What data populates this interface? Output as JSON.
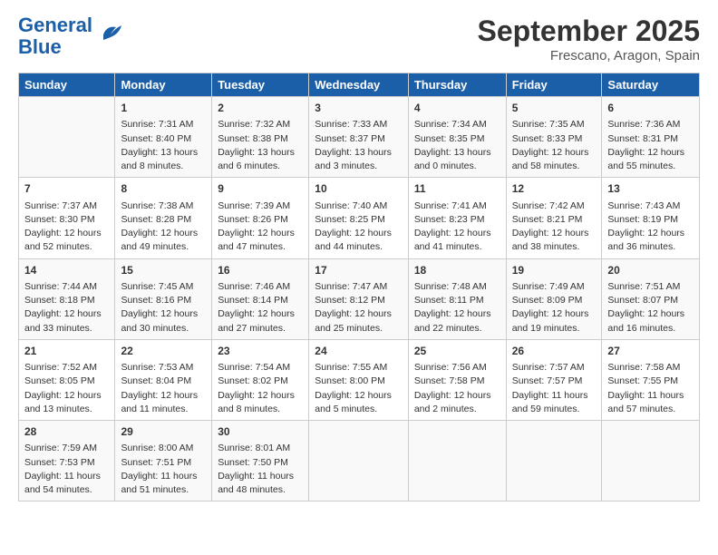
{
  "header": {
    "logo_line1": "General",
    "logo_line2": "Blue",
    "month": "September 2025",
    "location": "Frescano, Aragon, Spain"
  },
  "weekdays": [
    "Sunday",
    "Monday",
    "Tuesday",
    "Wednesday",
    "Thursday",
    "Friday",
    "Saturday"
  ],
  "weeks": [
    [
      {
        "day": "",
        "sunrise": "",
        "sunset": "",
        "daylight": ""
      },
      {
        "day": "1",
        "sunrise": "Sunrise: 7:31 AM",
        "sunset": "Sunset: 8:40 PM",
        "daylight": "Daylight: 13 hours and 8 minutes."
      },
      {
        "day": "2",
        "sunrise": "Sunrise: 7:32 AM",
        "sunset": "Sunset: 8:38 PM",
        "daylight": "Daylight: 13 hours and 6 minutes."
      },
      {
        "day": "3",
        "sunrise": "Sunrise: 7:33 AM",
        "sunset": "Sunset: 8:37 PM",
        "daylight": "Daylight: 13 hours and 3 minutes."
      },
      {
        "day": "4",
        "sunrise": "Sunrise: 7:34 AM",
        "sunset": "Sunset: 8:35 PM",
        "daylight": "Daylight: 13 hours and 0 minutes."
      },
      {
        "day": "5",
        "sunrise": "Sunrise: 7:35 AM",
        "sunset": "Sunset: 8:33 PM",
        "daylight": "Daylight: 12 hours and 58 minutes."
      },
      {
        "day": "6",
        "sunrise": "Sunrise: 7:36 AM",
        "sunset": "Sunset: 8:31 PM",
        "daylight": "Daylight: 12 hours and 55 minutes."
      }
    ],
    [
      {
        "day": "7",
        "sunrise": "Sunrise: 7:37 AM",
        "sunset": "Sunset: 8:30 PM",
        "daylight": "Daylight: 12 hours and 52 minutes."
      },
      {
        "day": "8",
        "sunrise": "Sunrise: 7:38 AM",
        "sunset": "Sunset: 8:28 PM",
        "daylight": "Daylight: 12 hours and 49 minutes."
      },
      {
        "day": "9",
        "sunrise": "Sunrise: 7:39 AM",
        "sunset": "Sunset: 8:26 PM",
        "daylight": "Daylight: 12 hours and 47 minutes."
      },
      {
        "day": "10",
        "sunrise": "Sunrise: 7:40 AM",
        "sunset": "Sunset: 8:25 PM",
        "daylight": "Daylight: 12 hours and 44 minutes."
      },
      {
        "day": "11",
        "sunrise": "Sunrise: 7:41 AM",
        "sunset": "Sunset: 8:23 PM",
        "daylight": "Daylight: 12 hours and 41 minutes."
      },
      {
        "day": "12",
        "sunrise": "Sunrise: 7:42 AM",
        "sunset": "Sunset: 8:21 PM",
        "daylight": "Daylight: 12 hours and 38 minutes."
      },
      {
        "day": "13",
        "sunrise": "Sunrise: 7:43 AM",
        "sunset": "Sunset: 8:19 PM",
        "daylight": "Daylight: 12 hours and 36 minutes."
      }
    ],
    [
      {
        "day": "14",
        "sunrise": "Sunrise: 7:44 AM",
        "sunset": "Sunset: 8:18 PM",
        "daylight": "Daylight: 12 hours and 33 minutes."
      },
      {
        "day": "15",
        "sunrise": "Sunrise: 7:45 AM",
        "sunset": "Sunset: 8:16 PM",
        "daylight": "Daylight: 12 hours and 30 minutes."
      },
      {
        "day": "16",
        "sunrise": "Sunrise: 7:46 AM",
        "sunset": "Sunset: 8:14 PM",
        "daylight": "Daylight: 12 hours and 27 minutes."
      },
      {
        "day": "17",
        "sunrise": "Sunrise: 7:47 AM",
        "sunset": "Sunset: 8:12 PM",
        "daylight": "Daylight: 12 hours and 25 minutes."
      },
      {
        "day": "18",
        "sunrise": "Sunrise: 7:48 AM",
        "sunset": "Sunset: 8:11 PM",
        "daylight": "Daylight: 12 hours and 22 minutes."
      },
      {
        "day": "19",
        "sunrise": "Sunrise: 7:49 AM",
        "sunset": "Sunset: 8:09 PM",
        "daylight": "Daylight: 12 hours and 19 minutes."
      },
      {
        "day": "20",
        "sunrise": "Sunrise: 7:51 AM",
        "sunset": "Sunset: 8:07 PM",
        "daylight": "Daylight: 12 hours and 16 minutes."
      }
    ],
    [
      {
        "day": "21",
        "sunrise": "Sunrise: 7:52 AM",
        "sunset": "Sunset: 8:05 PM",
        "daylight": "Daylight: 12 hours and 13 minutes."
      },
      {
        "day": "22",
        "sunrise": "Sunrise: 7:53 AM",
        "sunset": "Sunset: 8:04 PM",
        "daylight": "Daylight: 12 hours and 11 minutes."
      },
      {
        "day": "23",
        "sunrise": "Sunrise: 7:54 AM",
        "sunset": "Sunset: 8:02 PM",
        "daylight": "Daylight: 12 hours and 8 minutes."
      },
      {
        "day": "24",
        "sunrise": "Sunrise: 7:55 AM",
        "sunset": "Sunset: 8:00 PM",
        "daylight": "Daylight: 12 hours and 5 minutes."
      },
      {
        "day": "25",
        "sunrise": "Sunrise: 7:56 AM",
        "sunset": "Sunset: 7:58 PM",
        "daylight": "Daylight: 12 hours and 2 minutes."
      },
      {
        "day": "26",
        "sunrise": "Sunrise: 7:57 AM",
        "sunset": "Sunset: 7:57 PM",
        "daylight": "Daylight: 11 hours and 59 minutes."
      },
      {
        "day": "27",
        "sunrise": "Sunrise: 7:58 AM",
        "sunset": "Sunset: 7:55 PM",
        "daylight": "Daylight: 11 hours and 57 minutes."
      }
    ],
    [
      {
        "day": "28",
        "sunrise": "Sunrise: 7:59 AM",
        "sunset": "Sunset: 7:53 PM",
        "daylight": "Daylight: 11 hours and 54 minutes."
      },
      {
        "day": "29",
        "sunrise": "Sunrise: 8:00 AM",
        "sunset": "Sunset: 7:51 PM",
        "daylight": "Daylight: 11 hours and 51 minutes."
      },
      {
        "day": "30",
        "sunrise": "Sunrise: 8:01 AM",
        "sunset": "Sunset: 7:50 PM",
        "daylight": "Daylight: 11 hours and 48 minutes."
      },
      {
        "day": "",
        "sunrise": "",
        "sunset": "",
        "daylight": ""
      },
      {
        "day": "",
        "sunrise": "",
        "sunset": "",
        "daylight": ""
      },
      {
        "day": "",
        "sunrise": "",
        "sunset": "",
        "daylight": ""
      },
      {
        "day": "",
        "sunrise": "",
        "sunset": "",
        "daylight": ""
      }
    ]
  ]
}
